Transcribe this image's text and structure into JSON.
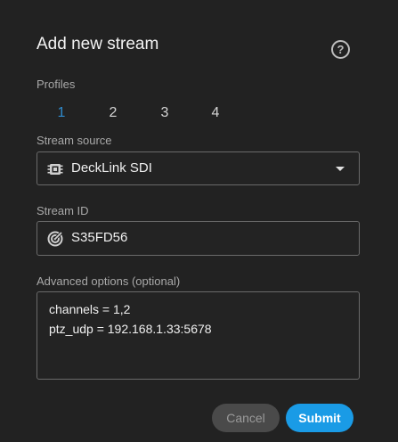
{
  "dialog": {
    "title": "Add new stream",
    "help_icon": "help-circle-icon",
    "help_glyph": "?"
  },
  "profiles": {
    "label": "Profiles",
    "items": [
      "1",
      "2",
      "3",
      "4"
    ],
    "selected": "1"
  },
  "stream_source": {
    "label": "Stream source",
    "value": "DeckLink SDI",
    "icon": "sdi-card-icon"
  },
  "stream_id": {
    "label": "Stream ID",
    "value": "S35FD56",
    "icon": "target-icon"
  },
  "advanced": {
    "label": "Advanced options (optional)",
    "lines": [
      "channels = 1,2",
      "ptz_udp = 192.168.1.33:5678"
    ]
  },
  "buttons": {
    "cancel": "Cancel",
    "submit": "Submit"
  },
  "colors": {
    "background": "#222222",
    "accent": "#1a9be6",
    "active_profile": "#2f8ccf"
  }
}
